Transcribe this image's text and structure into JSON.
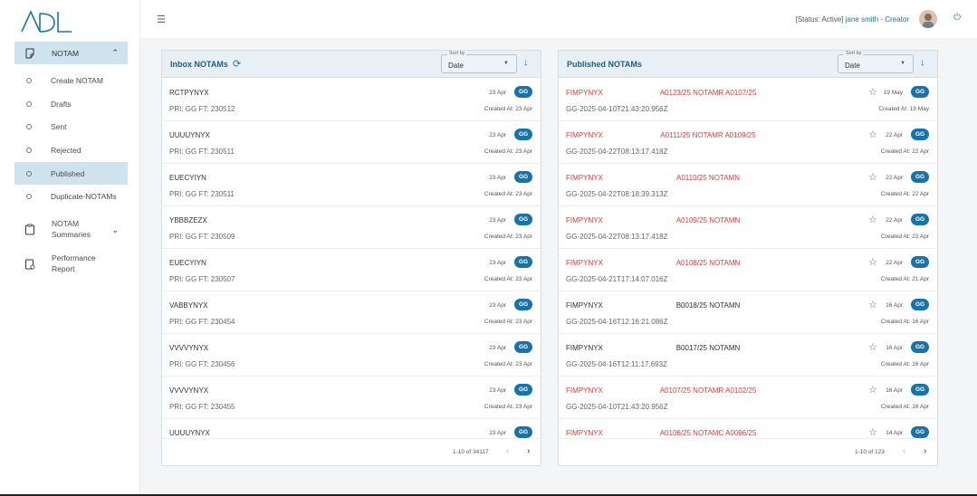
{
  "app": {
    "logo_text": "ADL"
  },
  "sidebar": {
    "notam_label": "NOTAM",
    "items": [
      {
        "label": "Create NOTAM"
      },
      {
        "label": "Drafts"
      },
      {
        "label": "Sent"
      },
      {
        "label": "Rejected"
      },
      {
        "label": "Published"
      },
      {
        "label": "Duplicate-NOTAMs"
      }
    ],
    "summaries_label_1": "NOTAM",
    "summaries_label_2": "Summaries",
    "performance_label_1": "Performance",
    "performance_label_2": "Report"
  },
  "header": {
    "status_text": "[Status: Active]",
    "user_text": "jane smith - Creator"
  },
  "inbox": {
    "title": "Inbox NOTAMs",
    "sort_label": "Sort by",
    "sort_value": "Date",
    "range": "1-10 of 34117",
    "rows": [
      {
        "name": "RCTPYNYX",
        "sub": "PRI: GG FT: 230512",
        "date": "23 Apr",
        "badge": "GG",
        "created": "Created At: 23 Apr"
      },
      {
        "name": "UUUUYNYX",
        "sub": "PRI: GG FT: 230511",
        "date": "23 Apr",
        "badge": "GG",
        "created": "Created At: 23 Apr"
      },
      {
        "name": "EUECYIYN",
        "sub": "PRI: GG FT: 230511",
        "date": "23 Apr",
        "badge": "GG",
        "created": "Created At: 23 Apr"
      },
      {
        "name": "YBBBZEZX",
        "sub": "PRI: GG FT: 230509",
        "date": "23 Apr",
        "badge": "GG",
        "created": "Created At: 23 Apr"
      },
      {
        "name": "EUECYIYN",
        "sub": "PRI: GG FT: 230507",
        "date": "23 Apr",
        "badge": "GG",
        "created": "Created At: 23 Apr"
      },
      {
        "name": "VABBYNYX",
        "sub": "PRI: GG FT: 230454",
        "date": "23 Apr",
        "badge": "GG",
        "created": "Created At: 23 Apr"
      },
      {
        "name": "VVVVYNYX",
        "sub": "PRI: GG FT: 230456",
        "date": "23 Apr",
        "badge": "GG",
        "created": "Created At: 23 Apr"
      },
      {
        "name": "VVVVYNYX",
        "sub": "PRI: GG FT: 230455",
        "date": "23 Apr",
        "badge": "GG",
        "created": "Created At: 23 Apr"
      },
      {
        "name": "UUUUYNYX",
        "sub": "",
        "date": "23 Apr",
        "badge": "GG",
        "created": ""
      }
    ]
  },
  "published": {
    "title": "Published NOTAMs",
    "sort_label": "Sort by",
    "sort_value": "Date",
    "range": "1-10 of 123",
    "rows": [
      {
        "name": "FIMPYNYX",
        "red": true,
        "code": "A0123/25 NOTAMR A0107/25",
        "sub": "GG-2025-04-10T21:43:20.956Z",
        "date": "19 May",
        "badge": "GG",
        "created": "Created At: 19 May"
      },
      {
        "name": "FIMPYNYX",
        "red": true,
        "code": "A0111/25 NOTAMR A0109/25",
        "sub": "GG-2025-04-22T08:13:17.418Z",
        "date": "22 Apr",
        "badge": "GG",
        "created": "Created At: 22 Apr"
      },
      {
        "name": "FIMPYNYX",
        "red": true,
        "code": "A0110/25 NOTAMN",
        "sub": "GG-2025-04-22T08:18:39.313Z",
        "date": "22 Apr",
        "badge": "GG",
        "created": "Created At: 22 Apr"
      },
      {
        "name": "FIMPYNYX",
        "red": true,
        "code": "A0109/25 NOTAMN",
        "sub": "GG-2025-04-22T08:13:17.418Z",
        "date": "22 Apr",
        "badge": "GG",
        "created": "Created At: 22 Apr"
      },
      {
        "name": "FIMPYNYX",
        "red": true,
        "code": "A0108/25 NOTAMN",
        "sub": "GG-2025-04-21T17:14:07.016Z",
        "date": "22 Apr",
        "badge": "GG",
        "created": "Created At: 21 Apr"
      },
      {
        "name": "FIMPYNYX",
        "red": false,
        "code": "B0018/25 NOTAMN",
        "sub": "GG-2025-04-16T12:16:21.086Z",
        "date": "16 Apr",
        "badge": "GG",
        "created": "Created At: 16 Apr"
      },
      {
        "name": "FIMPYNYX",
        "red": false,
        "code": "B0017/25 NOTAMN",
        "sub": "GG-2025-04-16T12:11:17.693Z",
        "date": "16 Apr",
        "badge": "GG",
        "created": "Created At: 16 Apr"
      },
      {
        "name": "FIMPYNYX",
        "red": true,
        "code": "A0107/25 NOTAMR A0102/25",
        "sub": "GG-2025-04-10T21:43:20.956Z",
        "date": "16 Apr",
        "badge": "GG",
        "created": "Created At: 16 Apr"
      },
      {
        "name": "FIMPYNYX",
        "red": true,
        "code": "A0106/25 NOTAMC A0096/25",
        "sub": "",
        "date": "14 Apr",
        "badge": "GG",
        "created": ""
      }
    ]
  },
  "colors": {
    "accent": "#1a73a8",
    "active_bg": "#cfe3ef",
    "alert_red": "#e03a3a"
  }
}
